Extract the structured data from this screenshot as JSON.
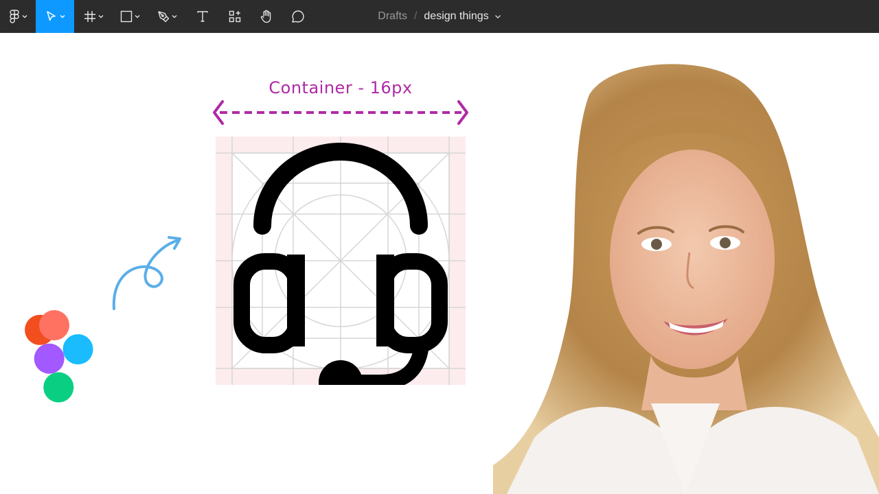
{
  "toolbar": {
    "tools": [
      {
        "name": "main-menu",
        "icon": "figma-menu-icon",
        "has_dropdown": true
      },
      {
        "name": "move",
        "icon": "cursor-arrow-icon",
        "has_dropdown": true,
        "active": true
      },
      {
        "name": "frame",
        "icon": "frame-hash-icon",
        "has_dropdown": true
      },
      {
        "name": "shape",
        "icon": "rectangle-icon",
        "has_dropdown": true
      },
      {
        "name": "pen",
        "icon": "pen-icon",
        "has_dropdown": true
      },
      {
        "name": "text",
        "icon": "text-icon",
        "has_dropdown": false
      },
      {
        "name": "resources",
        "icon": "resources-icon",
        "has_dropdown": false
      },
      {
        "name": "hand",
        "icon": "hand-icon",
        "has_dropdown": false
      },
      {
        "name": "comment",
        "icon": "comment-icon",
        "has_dropdown": false
      }
    ],
    "active_color": "#0d99ff",
    "background": "#2c2c2c"
  },
  "breadcrumb": {
    "project": "Drafts",
    "separator": "/",
    "file": "design things"
  },
  "canvas": {
    "label": "Container - 16px",
    "label_color": "#b02aa6",
    "main_icon": "headset-icon",
    "grid_fill": "#fdecee"
  },
  "presenter": {
    "subject": "presenter-photo"
  },
  "colors": {
    "figma_red": "#f24e1e",
    "figma_coral": "#ff7262",
    "figma_purple": "#a259ff",
    "figma_blue": "#1abcfe",
    "figma_green": "#0acf83",
    "doodle_blue": "#5aaee8"
  }
}
